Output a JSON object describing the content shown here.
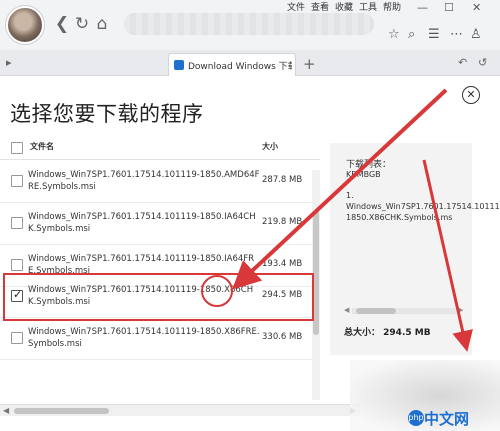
{
  "browser": {
    "menu": [
      "文件",
      "查看",
      "收藏",
      "工具",
      "帮助"
    ],
    "window_controls": [
      "—",
      "☐",
      "✕"
    ],
    "tab_title": "Download Windows 下载 Wi",
    "new_tab": "+"
  },
  "dialog": {
    "title": "选择您要下载的程序",
    "close": "✕",
    "header": {
      "file_name": "文件名",
      "size": "大小"
    },
    "rows": [
      {
        "name": "Windows_Win7SP1.7601.17514.101119-1850.AMD64FRE.Symbols.msi",
        "size": "287.8 MB",
        "checked": false
      },
      {
        "name": "Windows_Win7SP1.7601.17514.101119-1850.IA64CHK.Symbols.msi",
        "size": "219.8 MB",
        "checked": false
      },
      {
        "name": "Windows_Win7SP1.7601.17514.101119-1850.IA64FRE.Symbols.msi",
        "size": "193.4 MB",
        "checked": false
      },
      {
        "name": "Windows_Win7SP1.7601.17514.101119-1850.X86CHK.Symbols.msi",
        "size": "294.5 MB",
        "checked": true
      },
      {
        "name": "Windows_Win7SP1.7601.17514.101119-1850.X86FRE.Symbols.msi",
        "size": "330.6 MB",
        "checked": false
      }
    ]
  },
  "panel": {
    "title": "下载列表：",
    "unit": "KBMBGB",
    "items": [
      "1. Windows_Win7SP1.7601.17514.101119-1850.X86CHK.Symbols.ms"
    ],
    "total_label": "总大小：",
    "total_value": "294.5 MB"
  },
  "watermark": {
    "brand": "中文网",
    "badge": "php"
  },
  "colors": {
    "annotation_red": "#d9383a",
    "accent_blue": "#1f6fd1"
  }
}
